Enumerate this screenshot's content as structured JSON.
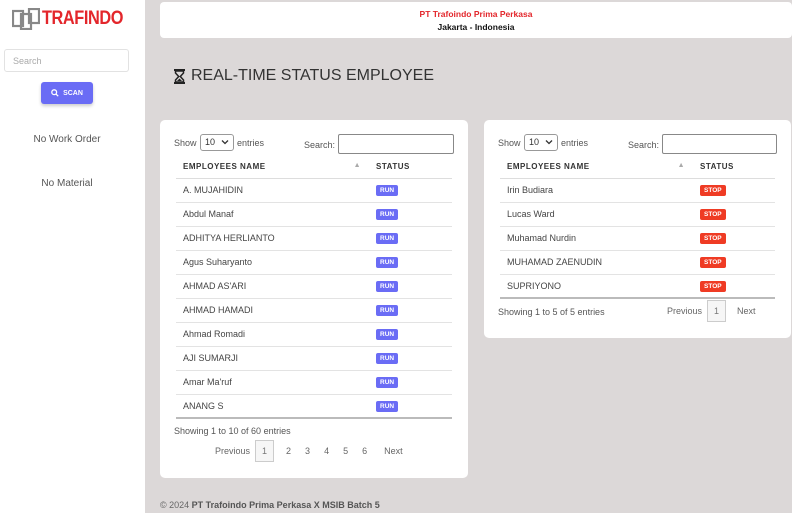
{
  "sidebar": {
    "logo_text": "TRAFINDO",
    "search_placeholder": "Search",
    "scan_label": "SCAN",
    "work_order": "No Work Order",
    "material": "No Material"
  },
  "header": {
    "company": "PT Trafoindo Prima Perkasa",
    "location": "Jakarta - Indonesia"
  },
  "page_title": "REAL-TIME STATUS EMPLOYEE",
  "left_table": {
    "show_label": "Show",
    "entries_value": "10",
    "entries_label": "entries",
    "search_label": "Search:",
    "col_name": "EMPLOYEES NAME",
    "col_status": "STATUS",
    "rows": [
      {
        "name": "A. MUJAHIDIN",
        "status": "RUN"
      },
      {
        "name": "Abdul Manaf",
        "status": "RUN"
      },
      {
        "name": "ADHITYA HERLIANTO",
        "status": "RUN"
      },
      {
        "name": "Agus Suharyanto",
        "status": "RUN"
      },
      {
        "name": "AHMAD AS'ARI",
        "status": "RUN"
      },
      {
        "name": "AHMAD HAMADI",
        "status": "RUN"
      },
      {
        "name": "Ahmad Romadi",
        "status": "RUN"
      },
      {
        "name": "AJI SUMARJI",
        "status": "RUN"
      },
      {
        "name": "Amar Ma'ruf",
        "status": "RUN"
      },
      {
        "name": "ANANG S",
        "status": "RUN"
      }
    ],
    "info": "Showing 1 to 10 of 60 entries",
    "previous": "Previous",
    "next": "Next",
    "pages": [
      "1",
      "2",
      "3",
      "4",
      "5",
      "6"
    ]
  },
  "right_table": {
    "show_label": "Show",
    "entries_value": "10",
    "entries_label": "entries",
    "search_label": "Search:",
    "col_name": "EMPLOYEES NAME",
    "col_status": "STATUS",
    "rows": [
      {
        "name": "Irin Budiara",
        "status": "STOP"
      },
      {
        "name": "Lucas Ward",
        "status": "STOP"
      },
      {
        "name": "Muhamad Nurdin",
        "status": "STOP"
      },
      {
        "name": "MUHAMAD ZAENUDIN",
        "status": "STOP"
      },
      {
        "name": "SUPRIYONO",
        "status": "STOP"
      }
    ],
    "info": "Showing 1 to 5 of 5 entries",
    "previous": "Previous",
    "next": "Next",
    "pages": [
      "1"
    ]
  },
  "footer": {
    "prefix": "© 2024",
    "text": "PT Trafoindo Prima Perkasa X MSIB Batch 5"
  },
  "colors": {
    "brand_red": "#e3262b",
    "run": "#6a6cf5",
    "stop": "#ef3b24"
  }
}
